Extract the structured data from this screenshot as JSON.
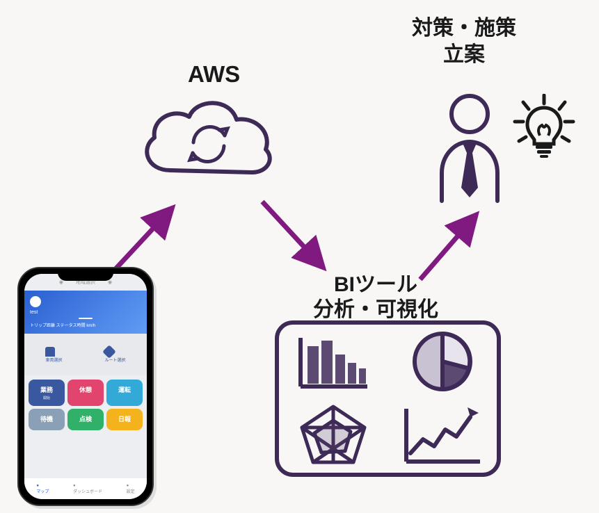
{
  "labels": {
    "aws": "AWS",
    "bi_line1": "BIツール",
    "bi_line2": "分析・可視化",
    "plan_line1": "対策・施策",
    "plan_line2": "立案"
  },
  "phone": {
    "topbar_text": "地域選択",
    "header": {
      "user": "test",
      "stat1_label": "トリップ距離  ステータス時間  km/h",
      "stat2_label": ""
    },
    "map": {
      "left": "車両選択",
      "right": "ルート選択"
    },
    "tiles": [
      {
        "label": "業務",
        "sub": "開始",
        "color": "#3a58a0"
      },
      {
        "label": "休憩",
        "sub": " ",
        "color": "#e1456e"
      },
      {
        "label": "運転",
        "sub": " ",
        "color": "#33a9d8"
      },
      {
        "label": "待機",
        "sub": " ",
        "color": "#8aa0b6"
      },
      {
        "label": "点検",
        "sub": " ",
        "color": "#31b06a"
      },
      {
        "label": "日報",
        "sub": " ",
        "color": "#f4b21c"
      }
    ],
    "nav": [
      {
        "label": "マップ",
        "active": true
      },
      {
        "label": "ダッシュボード",
        "active": false
      },
      {
        "label": "設定",
        "active": false
      }
    ]
  },
  "colors": {
    "stroke": "#3d2a56",
    "arrow": "#801a80",
    "accent": "#5c4a72"
  }
}
